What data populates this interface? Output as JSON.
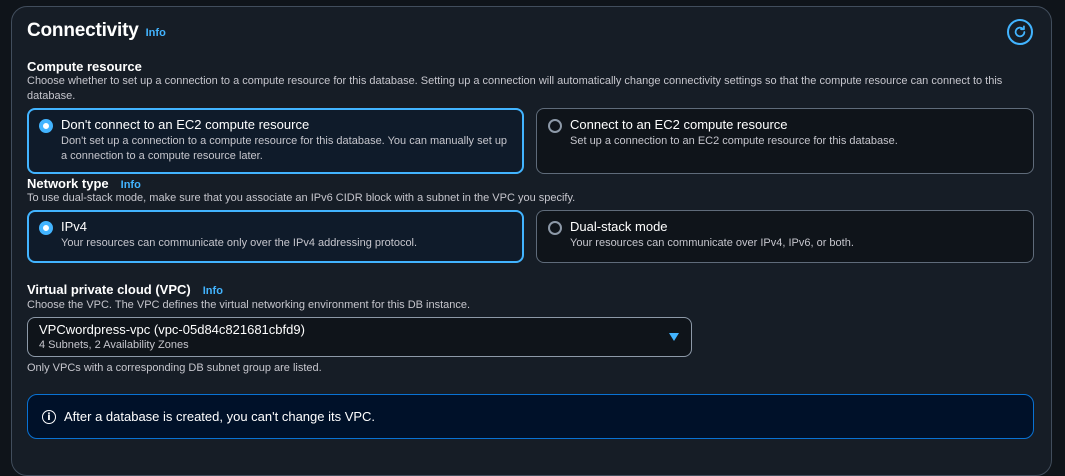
{
  "section": {
    "title": "Connectivity",
    "info_label": "Info",
    "refresh_icon": "refresh-icon"
  },
  "compute_resource": {
    "label": "Compute resource",
    "description": "Choose whether to set up a connection to a compute resource for this database. Setting up a connection will automatically change connectivity settings so that the compute resource can connect to this database.",
    "options": [
      {
        "title": "Don't connect to an EC2 compute resource",
        "description": "Don't set up a connection to a compute resource for this database. You can manually set up a connection to a compute resource later.",
        "selected": true
      },
      {
        "title": "Connect to an EC2 compute resource",
        "description": "Set up a connection to an EC2 compute resource for this database.",
        "selected": false
      }
    ]
  },
  "network_type": {
    "label": "Network type",
    "info_label": "Info",
    "description": "To use dual-stack mode, make sure that you associate an IPv6 CIDR block with a subnet in the VPC you specify.",
    "options": [
      {
        "title": "IPv4",
        "description": "Your resources can communicate only over the IPv4 addressing protocol.",
        "selected": true
      },
      {
        "title": "Dual-stack mode",
        "description": "Your resources can communicate over IPv4, IPv6, or both.",
        "selected": false
      }
    ]
  },
  "vpc": {
    "label": "Virtual private cloud (VPC)",
    "info_label": "Info",
    "description": "Choose the VPC. The VPC defines the virtual networking environment for this DB instance.",
    "selected_value": "VPCwordpress-vpc (vpc-05d84c821681cbfd9)",
    "selected_sub": "4 Subnets, 2 Availability Zones",
    "hint": "Only VPCs with a corresponding DB subnet group are listed."
  },
  "alert": {
    "text": "After a database is created, you can't change its VPC."
  },
  "colors": {
    "accent": "#42b4ff",
    "background": "#0f141a",
    "panel": "#161d26",
    "alert_border": "#0972d3"
  }
}
